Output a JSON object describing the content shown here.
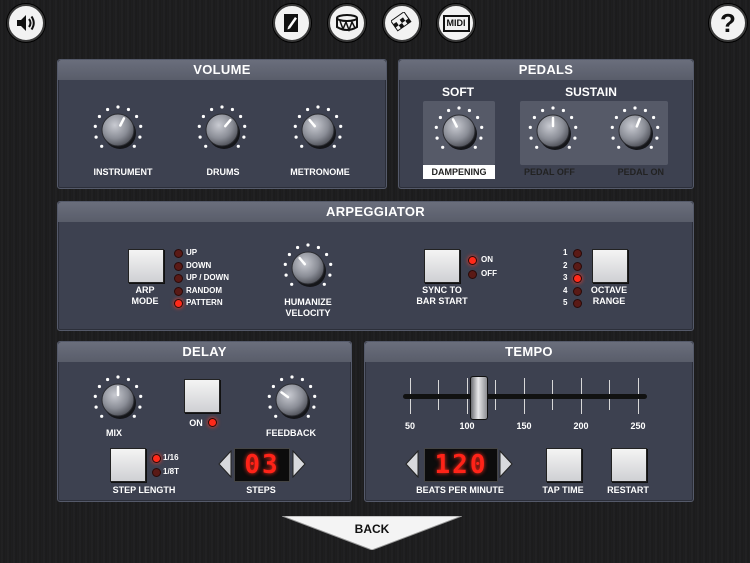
{
  "topbar": {
    "icons": [
      "speaker-icon",
      "pencil-icon",
      "drum-icon",
      "checkered-flag-icon",
      "midi-icon",
      "help-icon"
    ],
    "midi_label": "MIDI",
    "help_label": "?"
  },
  "volume": {
    "title": "VOLUME",
    "knobs": [
      {
        "label": "INSTRUMENT",
        "level": 0.6
      },
      {
        "label": "DRUMS",
        "level": 0.65
      },
      {
        "label": "METRONOME",
        "level": 0.35
      }
    ]
  },
  "pedals": {
    "title": "PEDALS",
    "soft_title": "SOFT",
    "sustain_title": "SUSTAIN",
    "dampening_label": "DAMPENING",
    "pedal_off_label": "PEDAL OFF",
    "pedal_on_label": "PEDAL ON"
  },
  "arpeggiator": {
    "title": "ARPEGGIATOR",
    "arp_mode_label": "ARP\nMODE",
    "modes": [
      {
        "label": "UP",
        "on": false
      },
      {
        "label": "DOWN",
        "on": false
      },
      {
        "label": "UP / DOWN",
        "on": false
      },
      {
        "label": "RANDOM",
        "on": false
      },
      {
        "label": "PATTERN",
        "on": true
      }
    ],
    "humanize_label": "HUMANIZE\nVELOCITY",
    "sync_label": "SYNC TO\nBAR START",
    "sync_on_label": "ON",
    "sync_off_label": "OFF",
    "sync_state": "ON",
    "octave_label": "OCTAVE\nRANGE",
    "octaves": [
      {
        "label": "1",
        "on": false
      },
      {
        "label": "2",
        "on": false
      },
      {
        "label": "3",
        "on": true
      },
      {
        "label": "4",
        "on": false
      },
      {
        "label": "5",
        "on": false
      }
    ]
  },
  "delay": {
    "title": "DELAY",
    "mix_label": "MIX",
    "on_label": "ON",
    "feedback_label": "FEEDBACK",
    "step_length_label": "STEP LENGTH",
    "step_options": [
      {
        "label": "1/16",
        "on": true
      },
      {
        "label": "1/8T",
        "on": false
      }
    ],
    "steps_label": "STEPS",
    "steps_value": "03"
  },
  "tempo": {
    "title": "TEMPO",
    "ticks": [
      "50",
      "100",
      "150",
      "200",
      "250"
    ],
    "slider_value": 110,
    "bpm_value": "120",
    "bpm_label": "BEATS PER MINUTE",
    "tap_time_label": "TAP TIME",
    "restart_label": "RESTART"
  },
  "back_label": "BACK"
}
